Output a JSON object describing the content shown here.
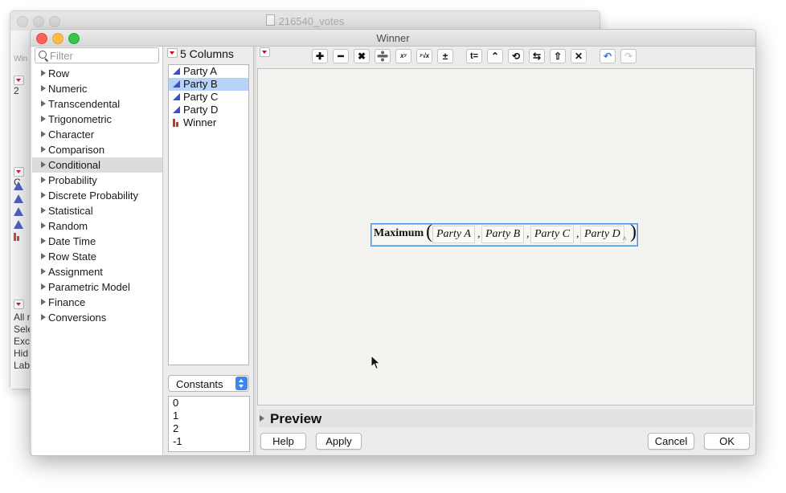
{
  "background_window": {
    "title": "216540_votes",
    "fragments": [
      "Win",
      "2",
      "C",
      "All r",
      "Sele",
      "Exc",
      "Hid",
      "Lab"
    ]
  },
  "window": {
    "title": "Winner"
  },
  "filter": {
    "placeholder": "Filter"
  },
  "function_categories": [
    "Row",
    "Numeric",
    "Transcendental",
    "Trigonometric",
    "Character",
    "Comparison",
    "Conditional",
    "Probability",
    "Discrete Probability",
    "Statistical",
    "Random",
    "Date Time",
    "Row State",
    "Assignment",
    "Parametric Model",
    "Finance",
    "Conversions"
  ],
  "selected_category": "Conditional",
  "columns": {
    "header": "5 Columns",
    "items": [
      {
        "name": "Party A",
        "type": "continuous"
      },
      {
        "name": "Party B",
        "type": "continuous",
        "selected": true
      },
      {
        "name": "Party C",
        "type": "continuous"
      },
      {
        "name": "Party D",
        "type": "continuous"
      },
      {
        "name": "Winner",
        "type": "nominal"
      }
    ]
  },
  "constants": {
    "selected": "Constants",
    "values": [
      "0",
      "1",
      "2",
      "-1"
    ]
  },
  "toolbar": {
    "buttons": [
      {
        "name": "add-icon",
        "glyph": "✚"
      },
      {
        "name": "subtract-icon",
        "glyph": "━"
      },
      {
        "name": "multiply-icon",
        "glyph": "✖"
      },
      {
        "name": "divide-icon",
        "glyph": "➗"
      },
      {
        "name": "power-icon",
        "glyph": "xʸ"
      },
      {
        "name": "root-icon",
        "glyph": "ʸ√x"
      },
      {
        "name": "plus-minus-icon",
        "glyph": "±"
      },
      {
        "name": "assign-icon",
        "glyph": "t="
      },
      {
        "name": "raise-icon",
        "glyph": "⌃"
      },
      {
        "name": "local-icon",
        "glyph": "⟲"
      },
      {
        "name": "swap-icon",
        "glyph": "⇆"
      },
      {
        "name": "peel-icon",
        "glyph": "⇧"
      },
      {
        "name": "clear-icon",
        "glyph": "✕"
      },
      {
        "name": "undo-icon",
        "glyph": "↶"
      },
      {
        "name": "redo-icon",
        "glyph": "↷"
      }
    ]
  },
  "formula": {
    "function": "Maximum",
    "args": [
      "Party A",
      "Party B",
      "Party C",
      "Party D"
    ],
    "separator": ",",
    "open": "(",
    "close": ")"
  },
  "preview": {
    "label": "Preview"
  },
  "buttons": {
    "help": "Help",
    "apply": "Apply",
    "cancel": "Cancel",
    "ok": "OK"
  }
}
